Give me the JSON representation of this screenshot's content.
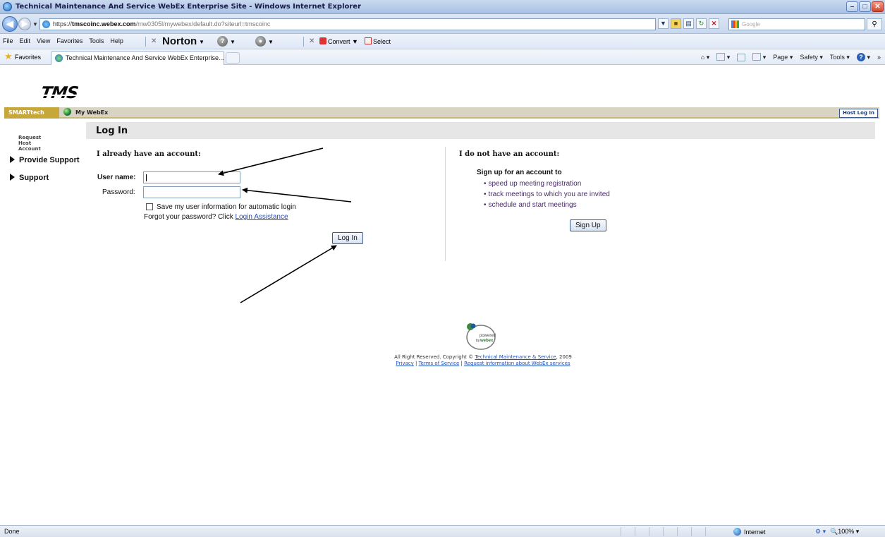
{
  "window": {
    "title": "Technical Maintenance And Service WebEx Enterprise Site - Windows Internet Explorer",
    "min": "–",
    "max": "□",
    "close": "✕"
  },
  "address": {
    "url_prefix": "https://",
    "url_host": "tmscoinc.webex.com",
    "url_path": "/mw0305l/mywebex/default.do?siteurl=tmscoinc",
    "search_placeholder": "Google"
  },
  "menu": {
    "items": [
      "File",
      "Edit",
      "View",
      "Favorites",
      "Tools",
      "Help"
    ],
    "norton": "Norton",
    "convert": "Convert",
    "select": "Select"
  },
  "favorites": {
    "label": "Favorites",
    "tab_title": "Technical Maintenance And Service WebEx Enterprise...",
    "page": "Page",
    "safety": "Safety",
    "tools": "Tools"
  },
  "site": {
    "logo": "TMS",
    "nav_smart": "SMARTtech",
    "nav_mywebex": "My WebEx",
    "host_login": "Host Log In"
  },
  "sidebar": {
    "request_host": "Request Host Account",
    "items": [
      "Provide Support",
      "Support"
    ]
  },
  "login": {
    "page_title": "Log In",
    "have_account": "I already have an account:",
    "username_label": "User name:",
    "password_label": "Password:",
    "username_value": "",
    "password_value": "",
    "remember": "Save my user information for automatic login",
    "forgot_text": "Forgot your password? Click ",
    "forgot_link": "Login Assistance",
    "login_button": "Log In"
  },
  "signup": {
    "no_account": "I do not have an account:",
    "heading": "Sign up for an account to",
    "bullets": [
      "speed up meeting registration",
      "track meetings to which you are invited",
      "schedule and start meetings"
    ],
    "button": "Sign Up"
  },
  "footer": {
    "powered": "powered",
    "by": "by",
    "webex": "webex",
    "rights": "All Right Reserved. Copyright © ",
    "company": "Technical Maintenance & Service",
    "year": ", 2009",
    "privacy": "Privacy",
    "terms": "Terms of Service",
    "request": "Request information about WebEx services",
    "divider": " | "
  },
  "status": {
    "text": "Done",
    "zone": "Internet",
    "zoom": "100%"
  }
}
